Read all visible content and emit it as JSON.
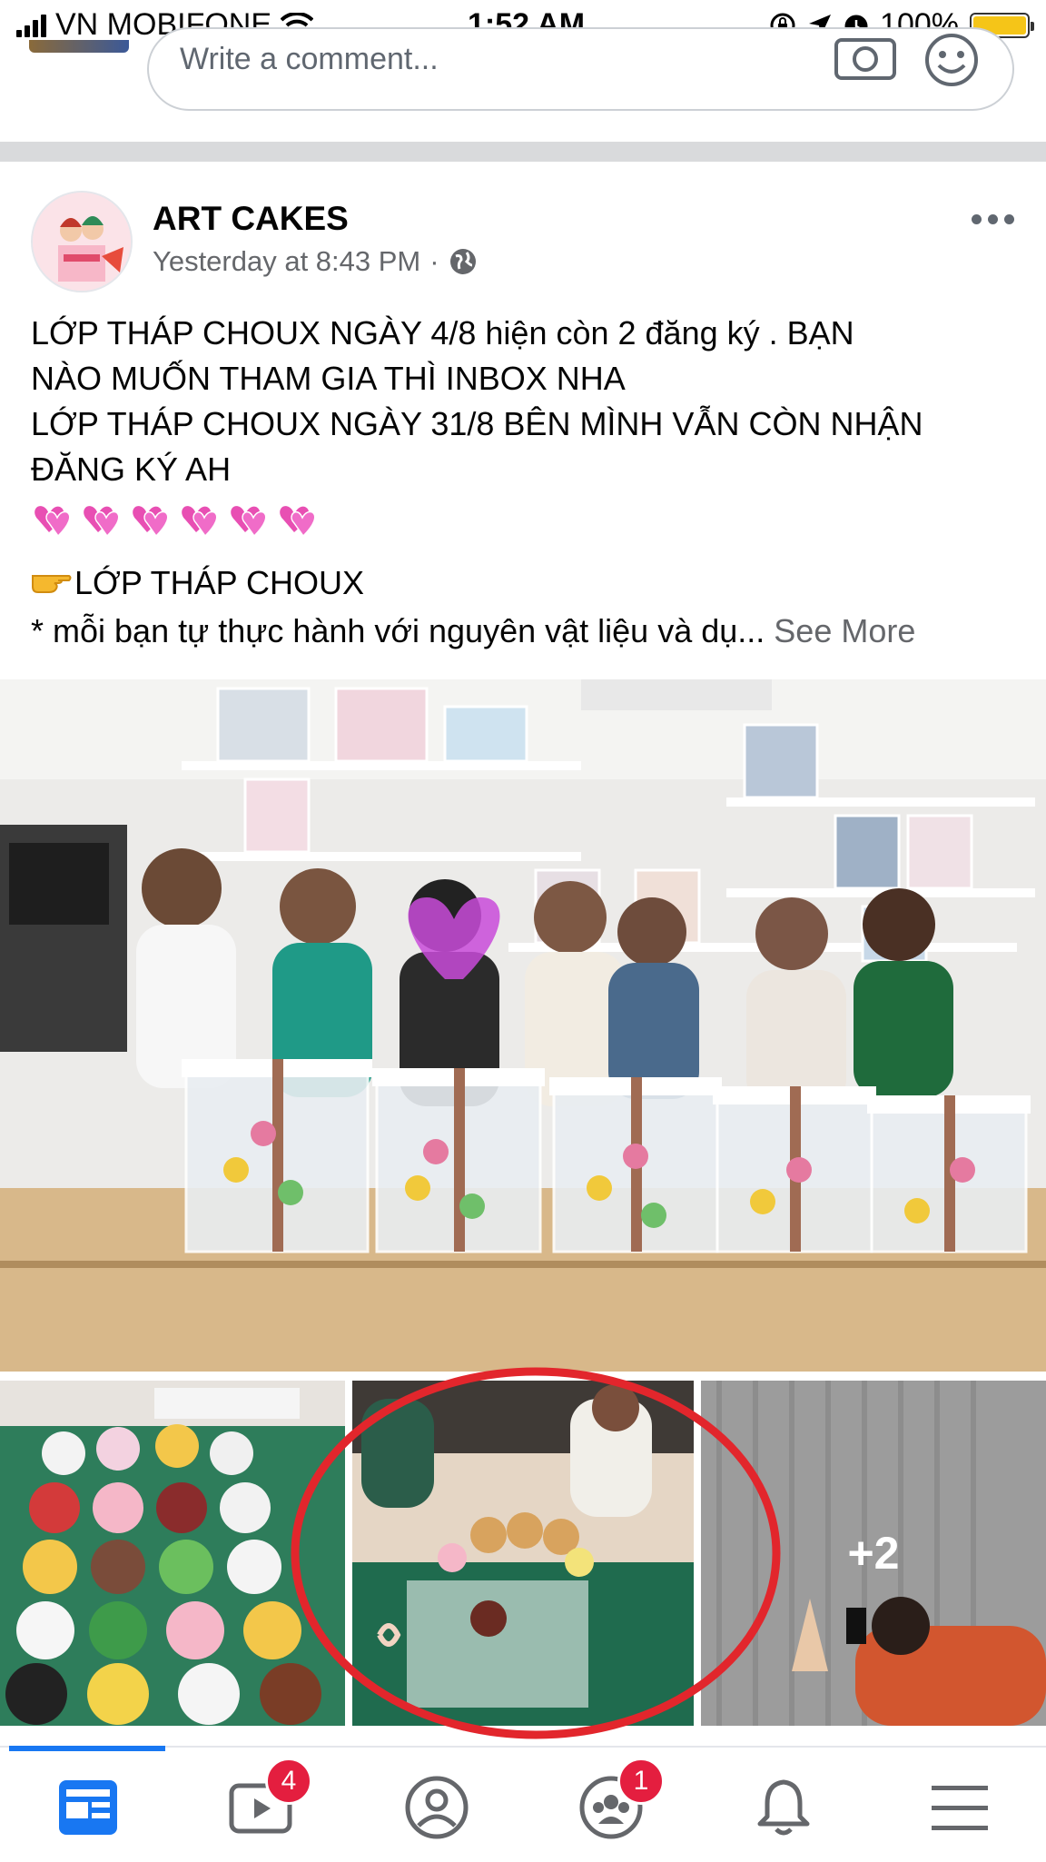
{
  "status_bar": {
    "carrier": "VN MOBIFONE",
    "time": "1:52 AM",
    "battery": "100%"
  },
  "comment": {
    "placeholder": "Write a comment..."
  },
  "post": {
    "author": "ART CAKES",
    "timestamp": "Yesterday at 8:43 PM",
    "separator_dot": "·",
    "text_lines": [
      "LỚP THÁP CHOUX NGÀY 4/8  hiện còn 2 đăng ký . BẠN",
      "NÀO MUỐN THAM GIA THÌ INBOX NHA",
      "LỚP THÁP CHOUX NGÀY 31/8 BÊN MÌNH VẪN CÒN NHẬN",
      "ĐĂNG KÝ AH"
    ],
    "heart_count": 6,
    "bullet_title": "LỚP THÁP CHOUX",
    "bullet_text": "* mỗi bạn tự thực hành với nguyên vật liệu và dụ...",
    "see_more": "See More",
    "extra_photos": "+2"
  },
  "nav": {
    "items": [
      {
        "name": "news-feed",
        "badge": ""
      },
      {
        "name": "watch",
        "badge": "4"
      },
      {
        "name": "profile",
        "badge": ""
      },
      {
        "name": "groups",
        "badge": "1"
      },
      {
        "name": "notifications",
        "badge": ""
      },
      {
        "name": "menu",
        "badge": ""
      }
    ]
  },
  "colors": {
    "facebook_blue": "#1877f2",
    "badge_red": "#e41e3f",
    "highlight_circle": "#e2262c"
  }
}
